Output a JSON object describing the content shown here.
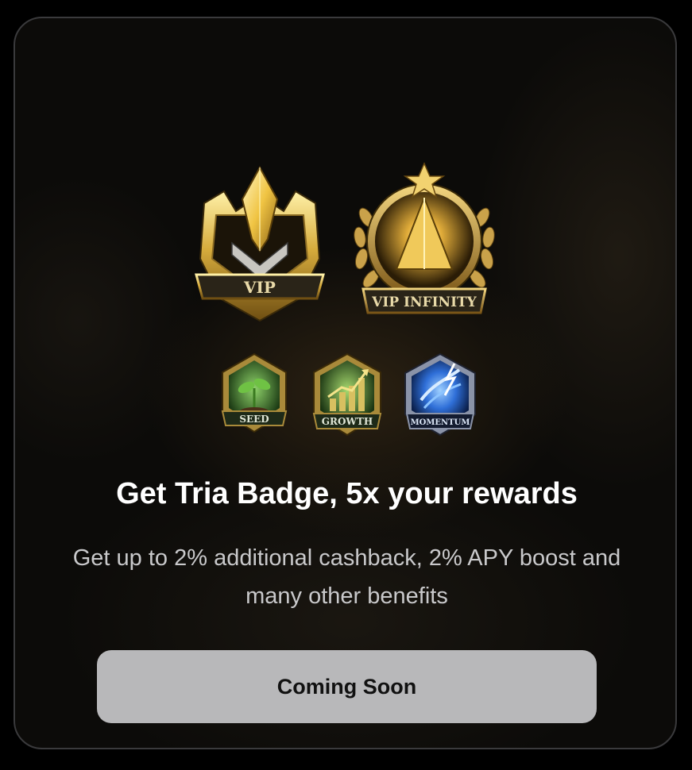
{
  "badges": {
    "vip": {
      "label": "VIP",
      "icon": "vip-crystal-badge-icon"
    },
    "vip_infinity": {
      "label": "VIP INFINITY",
      "icon": "vip-infinity-laurel-badge-icon"
    },
    "seed": {
      "label": "SEED",
      "icon": "seed-sprout-badge-icon"
    },
    "growth": {
      "label": "GROWTH",
      "icon": "growth-chart-badge-icon"
    },
    "momentum": {
      "label": "MOMENTUM",
      "icon": "momentum-bolt-badge-icon"
    }
  },
  "promo": {
    "title": "Get Tria Badge, 5x your rewards",
    "subtitle": "Get up to 2% additional cashback, 2% APY boost and many other benefits"
  },
  "cta": {
    "label": "Coming Soon"
  },
  "colors": {
    "card_border": "#3a3a3c",
    "title": "#ffffff",
    "subtitle": "#c9c9cb",
    "cta_background": "#b8b8ba",
    "cta_text": "#111111",
    "gold": "#d9b44a",
    "green": "#4f9a3a",
    "blue": "#3f7fe0"
  }
}
